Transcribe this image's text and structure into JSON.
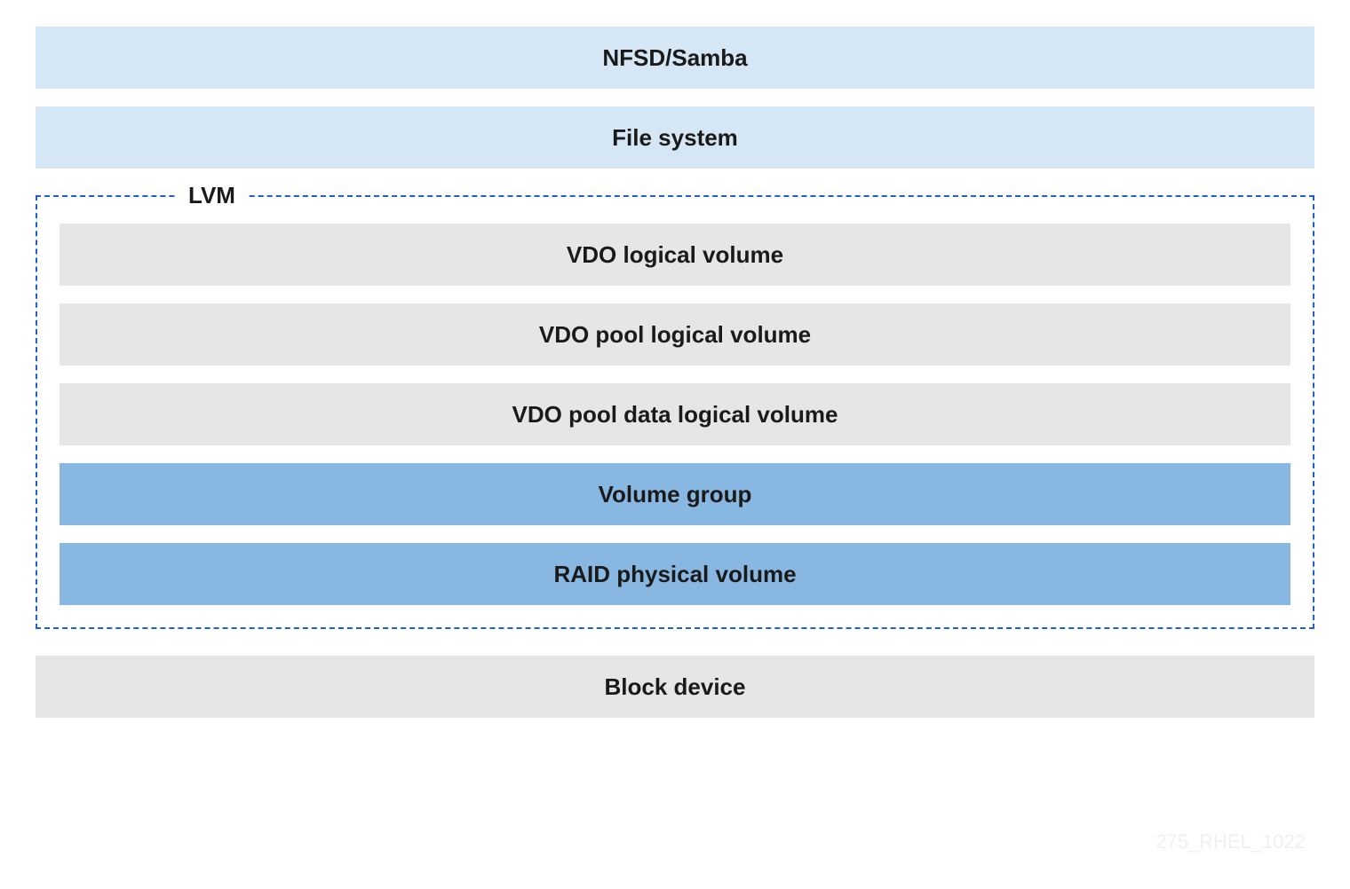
{
  "watermark": "275_RHEL_1022",
  "lvm_label": "LVM",
  "layers": {
    "nfsd_samba": "NFSD/Samba",
    "file_system": "File system",
    "vdo_logical": "VDO logical volume",
    "vdo_pool_logical": "VDO pool logical volume",
    "vdo_pool_data": "VDO pool data logical volume",
    "volume_group": "Volume group",
    "raid_physical": "RAID physical volume",
    "block_device": "Block device"
  },
  "colors": {
    "light_blue": "#d5e7f5",
    "grey": "#e6e6e6",
    "blue": "#88b8e2",
    "dash_border": "#1d5fd6"
  }
}
